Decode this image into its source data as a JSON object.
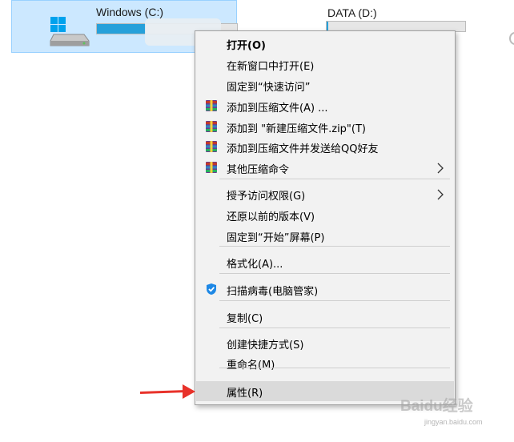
{
  "drives": [
    {
      "name": "Windows (C:)",
      "usage_fraction": 0.35
    },
    {
      "name": "DATA (D:)",
      "usage_fraction": 0.01
    }
  ],
  "colors": {
    "selection_bg": "#cce8ff",
    "selection_border": "#99d1ff",
    "menu_bg": "#f2f2f2",
    "hover_bg": "#dadada",
    "annotation_arrow": "#e8322a",
    "usage_bar": "#26a0da"
  },
  "context_menu": {
    "items": [
      {
        "label": "打开(O)",
        "bold": true,
        "icon": null
      },
      {
        "label": "在新窗口中打开(E)",
        "icon": null
      },
      {
        "label": "固定到“快速访问”",
        "icon": null
      },
      {
        "label": "添加到压缩文件(A) ...",
        "icon": "winrar-archive-icon"
      },
      {
        "label": "添加到 \"新建压缩文件.zip\"(T)",
        "icon": "winrar-archive-icon"
      },
      {
        "label": "添加到压缩文件并发送给QQ好友",
        "icon": "winrar-archive-icon"
      },
      {
        "label": "其他压缩命令",
        "icon": "winrar-archive-icon",
        "submenu": true
      },
      {
        "label": "授予访问权限(G)",
        "icon": null,
        "submenu": true
      },
      {
        "label": "还原以前的版本(V)",
        "icon": null
      },
      {
        "label": "固定到“开始”屏幕(P)",
        "icon": null
      },
      {
        "label": "格式化(A)...",
        "icon": null
      },
      {
        "label": "扫描病毒(电脑管家)",
        "icon": "tencent-shield-icon"
      },
      {
        "label": "复制(C)",
        "icon": null
      },
      {
        "label": "创建快捷方式(S)",
        "icon": null
      },
      {
        "label": "重命名(M)",
        "icon": null
      },
      {
        "label": "属性(R)",
        "icon": null,
        "highlighted": true
      }
    ]
  },
  "watermark": {
    "text": "Baidu经验",
    "sub": "jingyan.baidu.com"
  }
}
